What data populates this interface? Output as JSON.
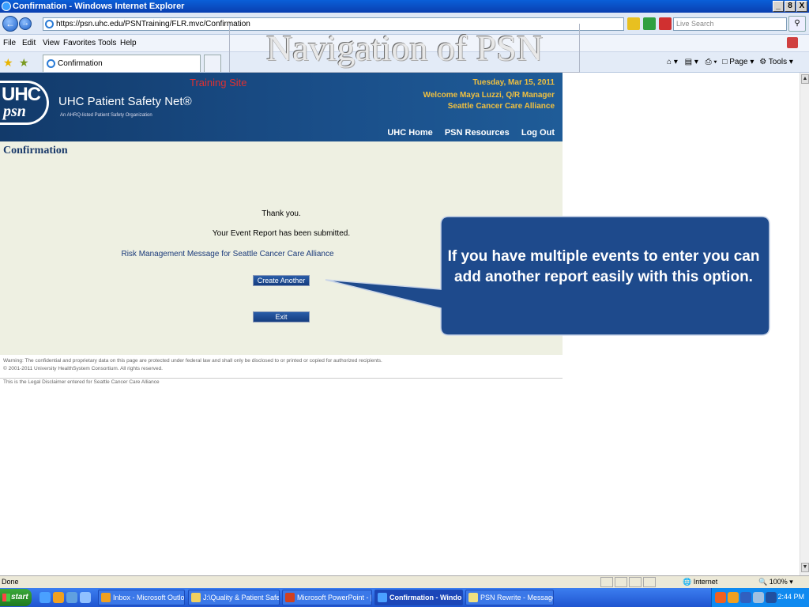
{
  "window": {
    "title": "Confirmation - Windows Internet Explorer",
    "min": "_",
    "max": "8",
    "close": "X"
  },
  "address": {
    "url": "https://psn.uhc.edu/PSNTraining/FLR.mvc/Confirmation",
    "search_placeholder": "Live Search"
  },
  "menu": [
    "File",
    "Edit",
    "View",
    "Favorites",
    "Tools",
    "Help"
  ],
  "tabs": {
    "active": "Confirmation"
  },
  "command_bar": {
    "page": "Page",
    "tools": "Tools"
  },
  "slide": {
    "title": "Navigation of PSN"
  },
  "site": {
    "logo_top": "UHC",
    "logo_bottom": "psn",
    "name": "UHC Patient Safety Net®",
    "tagline": "An AHRQ-listed Patient Safety Organization",
    "training": "Training Site",
    "date": "Tuesday, Mar 15, 2011",
    "welcome": "Welcome Maya Luzzi, Q/R Manager",
    "org": "Seattle Cancer Care Alliance",
    "nav": [
      "UHC Home",
      "PSN Resources",
      "Log Out"
    ]
  },
  "content": {
    "heading": "Confirmation",
    "thanks": "Thank you.",
    "submitted": "Your Event Report has been submitted.",
    "risk_message": "Risk Management Message for Seattle Cancer Care Alliance",
    "create_button": "Create Another",
    "exit_button": "Exit"
  },
  "footer": {
    "warning": "Warning: The confidential and proprietary data on this page are protected under federal law and shall only be disclosed to or printed or copied for authorized recipients.",
    "copyright": "© 2001-2011 University HealthSystem Consortium. All rights reserved.",
    "disclaimer": "This is the Legal Disclaimer entered for Seattle Cancer Care Alliance"
  },
  "callout": {
    "text": "If you have multiple events to enter you can add another report easily with this option."
  },
  "status": {
    "left": "Done",
    "zone": "Internet",
    "zoom": "100%"
  },
  "taskbar": {
    "start": "start",
    "tasks": [
      "Inbox - Microsoft Outlook",
      "J:\\Quality & Patient Safe...",
      "Microsoft PowerPoint - [L...",
      "Confirmation - Windo...",
      "PSN Rewrite - Message (..."
    ],
    "clock": "2:44 PM"
  },
  "colors": {
    "header_blue": "#1a4f8a",
    "accent_gold": "#f0c040",
    "training_red": "#e03030",
    "content_bg": "#eef0e2",
    "callout_fill": "#1e4a8c"
  }
}
